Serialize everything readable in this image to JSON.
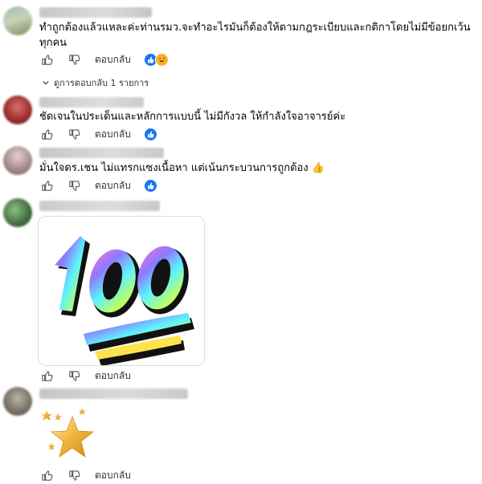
{
  "comments": [
    {
      "text": "ทำถูกต้องแล้วแหละค่ะท่านรมว.จะทำอะไรมันก็ต้องให้ตามกฎระเบียบและกติกาโดยไม่มีข้อยกเว้นทุกคน",
      "reply_label": "ตอบกลับ",
      "reactions": [
        "like-reaction-icon",
        "laughing-reaction-icon"
      ],
      "view_replies": "ดูการตอบกลับ 1 รายการ"
    },
    {
      "text": "ชัดเจนในประเด็นและหลักการแบบนี้ ไม่มีกังวล ให้กำลังใจอาจารย์ค่ะ",
      "reply_label": "ตอบกลับ",
      "reactions": [
        "like-reaction-icon"
      ]
    },
    {
      "text": "มั่นใจดร.เชน ไม่แทรกแซงเนื้อหา แต่เน้นกระบวนการถูกต้อง 👍",
      "reply_label": "ตอบกลับ",
      "reactions": [
        "like-reaction-icon"
      ]
    },
    {
      "sticker": "100",
      "reply_label": "ตอบกลับ"
    },
    {
      "emoji_sticker": "stars-sticker",
      "reply_label": "ตอบกลับ"
    }
  ],
  "colors": {
    "like_blue": "#1877f2",
    "haha_yellow": "#f7b125"
  }
}
